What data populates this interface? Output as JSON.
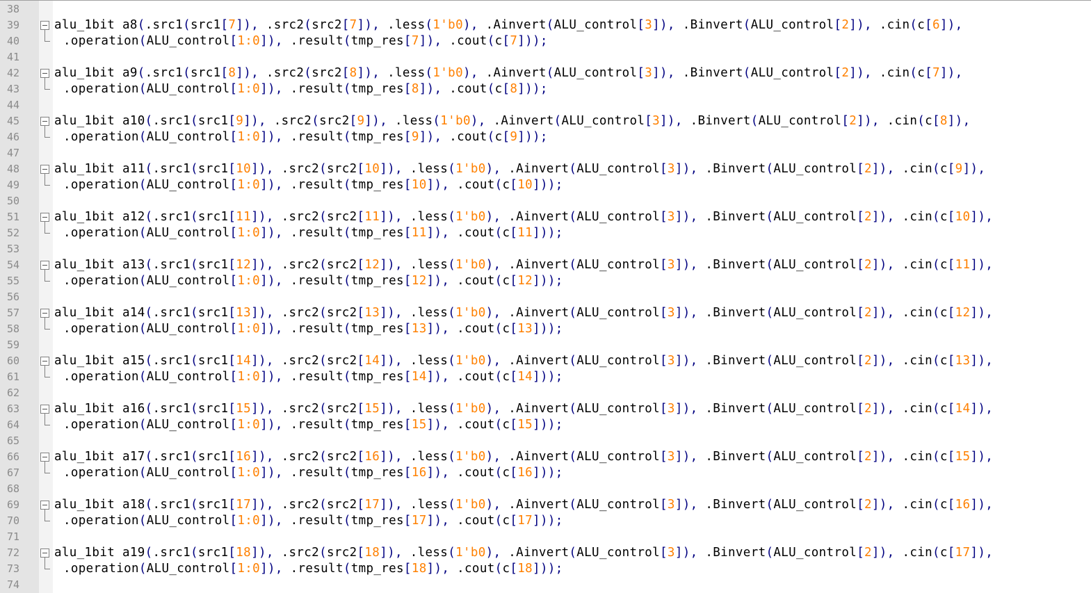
{
  "editor": {
    "colors": {
      "default_text": "#000000",
      "operator": "#000080",
      "number": "#ff8000",
      "line_number": "#8a8a8a",
      "gutter_bg": "#e4e4e4"
    },
    "line_numbers": [
      "38",
      "39",
      "40",
      "41",
      "42",
      "43",
      "44",
      "45",
      "46",
      "47",
      "48",
      "49",
      "50",
      "51",
      "52",
      "53",
      "54",
      "55",
      "56",
      "57",
      "58",
      "59",
      "60",
      "61",
      "62",
      "63",
      "64",
      "65",
      "66",
      "67",
      "68",
      "69",
      "70",
      "71",
      "72",
      "73",
      "74"
    ],
    "instances": [
      {
        "name": "a8",
        "src": "7",
        "cin": "6"
      },
      {
        "name": "a9",
        "src": "8",
        "cin": "7"
      },
      {
        "name": "a10",
        "src": "9",
        "cin": "8"
      },
      {
        "name": "a11",
        "src": "10",
        "cin": "9"
      },
      {
        "name": "a12",
        "src": "11",
        "cin": "10"
      },
      {
        "name": "a13",
        "src": "12",
        "cin": "11"
      },
      {
        "name": "a14",
        "src": "13",
        "cin": "12"
      },
      {
        "name": "a15",
        "src": "14",
        "cin": "13"
      },
      {
        "name": "a16",
        "src": "15",
        "cin": "14"
      },
      {
        "name": "a17",
        "src": "16",
        "cin": "15"
      },
      {
        "name": "a18",
        "src": "17",
        "cin": "16"
      },
      {
        "name": "a19",
        "src": "18",
        "cin": "17"
      }
    ],
    "tokens": {
      "module": "alu_1bit",
      "src1_port": ".src1",
      "src1_sig": "src1",
      "src2_port": ".src2",
      "src2_sig": "src2",
      "less_port": ".less",
      "less_val": "1'b0",
      "ainvert_port": ".Ainvert",
      "ainvert_sig": "ALU_control",
      "ainvert_idx": "3",
      "binvert_port": ".Binvert",
      "binvert_sig": "ALU_control",
      "binvert_idx": "2",
      "cin_port": ".cin",
      "cin_sig": "c",
      "operation_port": ".operation",
      "operation_sig": "ALU_control",
      "operation_idx": "1:0",
      "result_port": ".result",
      "result_sig": "tmp_res",
      "cout_port": ".cout",
      "cout_sig": "c"
    }
  }
}
